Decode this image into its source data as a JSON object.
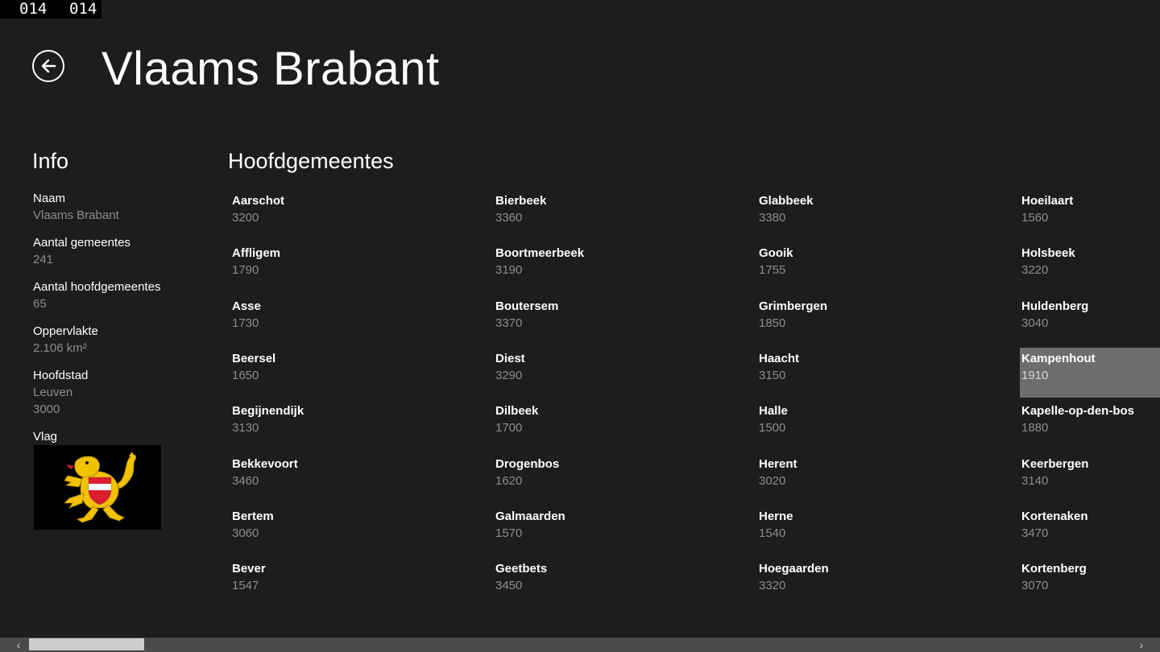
{
  "debug_counter": {
    "a": "014",
    "b": "014"
  },
  "header": {
    "title": "Vlaams Brabant"
  },
  "info": {
    "heading": "Info",
    "items": [
      {
        "label": "Naam",
        "values": [
          "Vlaams Brabant"
        ]
      },
      {
        "label": "Aantal gemeentes",
        "values": [
          "241"
        ]
      },
      {
        "label": "Aantal hoofdgemeentes",
        "values": [
          "65"
        ]
      },
      {
        "label": "Oppervlakte",
        "values": [
          "2.106 km²"
        ]
      },
      {
        "label": "Hoofdstad",
        "values": [
          "Leuven",
          "3000"
        ]
      }
    ],
    "flag_label": "Vlag"
  },
  "municipalities": {
    "heading": "Hoofdgemeentes",
    "selected": "Kampenhout",
    "columns": [
      [
        {
          "name": "Aarschot",
          "code": "3200"
        },
        {
          "name": "Affligem",
          "code": "1790"
        },
        {
          "name": "Asse",
          "code": "1730"
        },
        {
          "name": "Beersel",
          "code": "1650"
        },
        {
          "name": "Begijnendijk",
          "code": "3130"
        },
        {
          "name": "Bekkevoort",
          "code": "3460"
        },
        {
          "name": "Bertem",
          "code": "3060"
        },
        {
          "name": "Bever",
          "code": "1547"
        }
      ],
      [
        {
          "name": "Bierbeek",
          "code": "3360"
        },
        {
          "name": "Boortmeerbeek",
          "code": "3190"
        },
        {
          "name": "Boutersem",
          "code": "3370"
        },
        {
          "name": "Diest",
          "code": "3290"
        },
        {
          "name": "Dilbeek",
          "code": "1700"
        },
        {
          "name": "Drogenbos",
          "code": "1620"
        },
        {
          "name": "Galmaarden",
          "code": "1570"
        },
        {
          "name": "Geetbets",
          "code": "3450"
        }
      ],
      [
        {
          "name": "Glabbeek",
          "code": "3380"
        },
        {
          "name": "Gooik",
          "code": "1755"
        },
        {
          "name": "Grimbergen",
          "code": "1850"
        },
        {
          "name": "Haacht",
          "code": "3150"
        },
        {
          "name": "Halle",
          "code": "1500"
        },
        {
          "name": "Herent",
          "code": "3020"
        },
        {
          "name": "Herne",
          "code": "1540"
        },
        {
          "name": "Hoegaarden",
          "code": "3320"
        }
      ],
      [
        {
          "name": "Hoeilaart",
          "code": "1560"
        },
        {
          "name": "Holsbeek",
          "code": "3220"
        },
        {
          "name": "Huldenberg",
          "code": "3040"
        },
        {
          "name": "Kampenhout",
          "code": "1910"
        },
        {
          "name": "Kapelle-op-den-bos",
          "code": "1880"
        },
        {
          "name": "Keerbergen",
          "code": "3140"
        },
        {
          "name": "Kortenaken",
          "code": "3470"
        },
        {
          "name": "Kortenberg",
          "code": "3070"
        }
      ]
    ]
  },
  "scrollbar": {
    "position": 0.0
  },
  "colors": {
    "background": "#1d1d1d",
    "secondary_text": "#8c8c8c",
    "selected_tile": "#6d6d6d",
    "flag_gold": "#f2c200",
    "flag_red": "#d81e2c"
  },
  "icons": {
    "back": "back-arrow-circle-icon",
    "scroll_left": "chevron-left-icon",
    "scroll_right": "chevron-right-icon"
  }
}
